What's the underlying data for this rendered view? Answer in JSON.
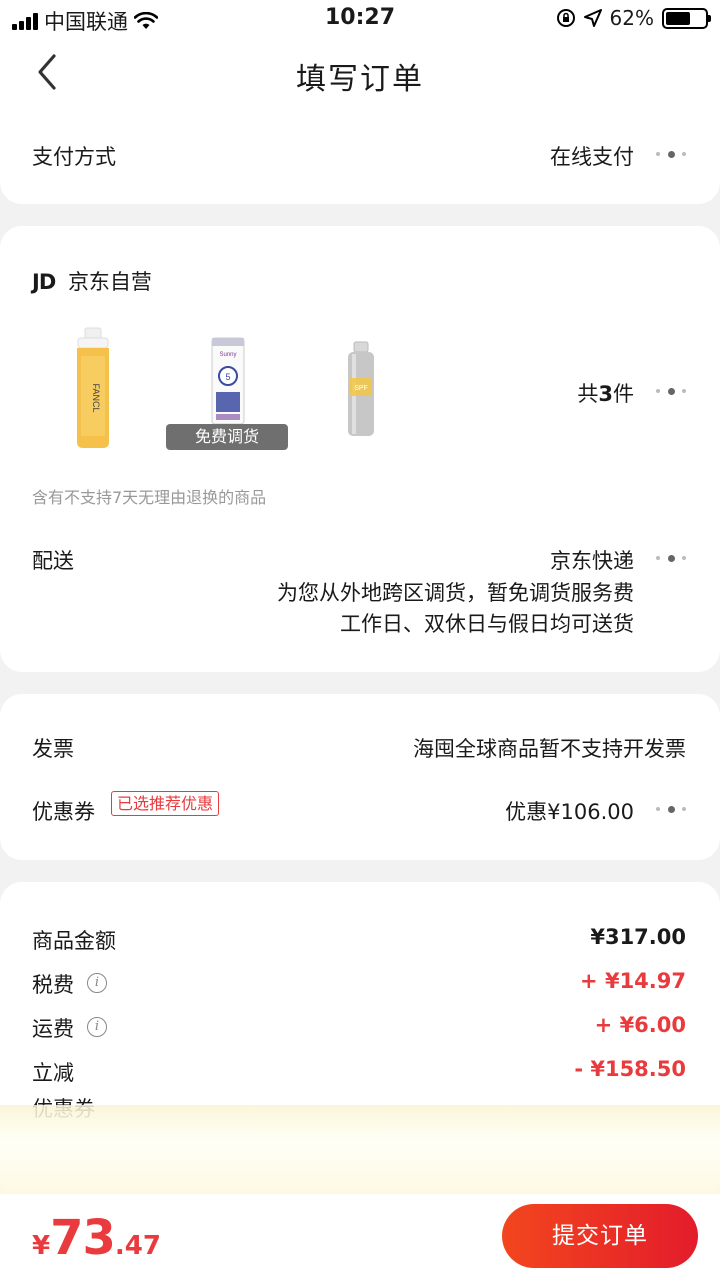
{
  "status_bar": {
    "carrier": "中国联通",
    "time": "10:27",
    "battery_percent": "62%",
    "battery_level": 0.62
  },
  "header": {
    "title": "填写订单"
  },
  "payment": {
    "label": "支付方式",
    "value": "在线支付"
  },
  "store": {
    "logo_text": "JD",
    "name": "京东自营",
    "free_transfer_tag": "免费调货",
    "count_prefix": "共",
    "count": "3",
    "count_suffix": "件",
    "return_notice": "含有不支持7天无理由退换的商品",
    "products": [
      {
        "icon": "fancl-bottle-icon"
      },
      {
        "icon": "sunscreen-tube-icon"
      },
      {
        "icon": "spray-can-icon"
      }
    ]
  },
  "delivery": {
    "label": "配送",
    "carrier": "京东快递",
    "line1": "为您从外地跨区调货，暂免调货服务费",
    "line2": "工作日、双休日与假日均可送货"
  },
  "invoice": {
    "label": "发票",
    "value": "海囤全球商品暂不支持开发票"
  },
  "coupon": {
    "label": "优惠券",
    "tag": "已选推荐优惠",
    "value": "优惠¥106.00"
  },
  "summary": {
    "items": [
      {
        "label": "商品金额",
        "value": "¥317.00",
        "color": "#1a1a1a"
      },
      {
        "label": "税费",
        "value": "+ ¥14.97",
        "color": "#e93b3d",
        "info": true
      },
      {
        "label": "运费",
        "value": "+ ¥6.00",
        "color": "#e93b3d",
        "info": true
      },
      {
        "label": "立减",
        "value": "- ¥158.50",
        "color": "#e93b3d"
      }
    ],
    "partial_label": "优惠券"
  },
  "bottom": {
    "currency": "¥",
    "price_int": "73",
    "price_dec": ".47",
    "submit_label": "提交订单"
  },
  "colors": {
    "accent": "#e93b3d",
    "button_gradient_start": "#f2461e",
    "button_gradient_end": "#e31c2b",
    "background": "#f2f2f2"
  }
}
